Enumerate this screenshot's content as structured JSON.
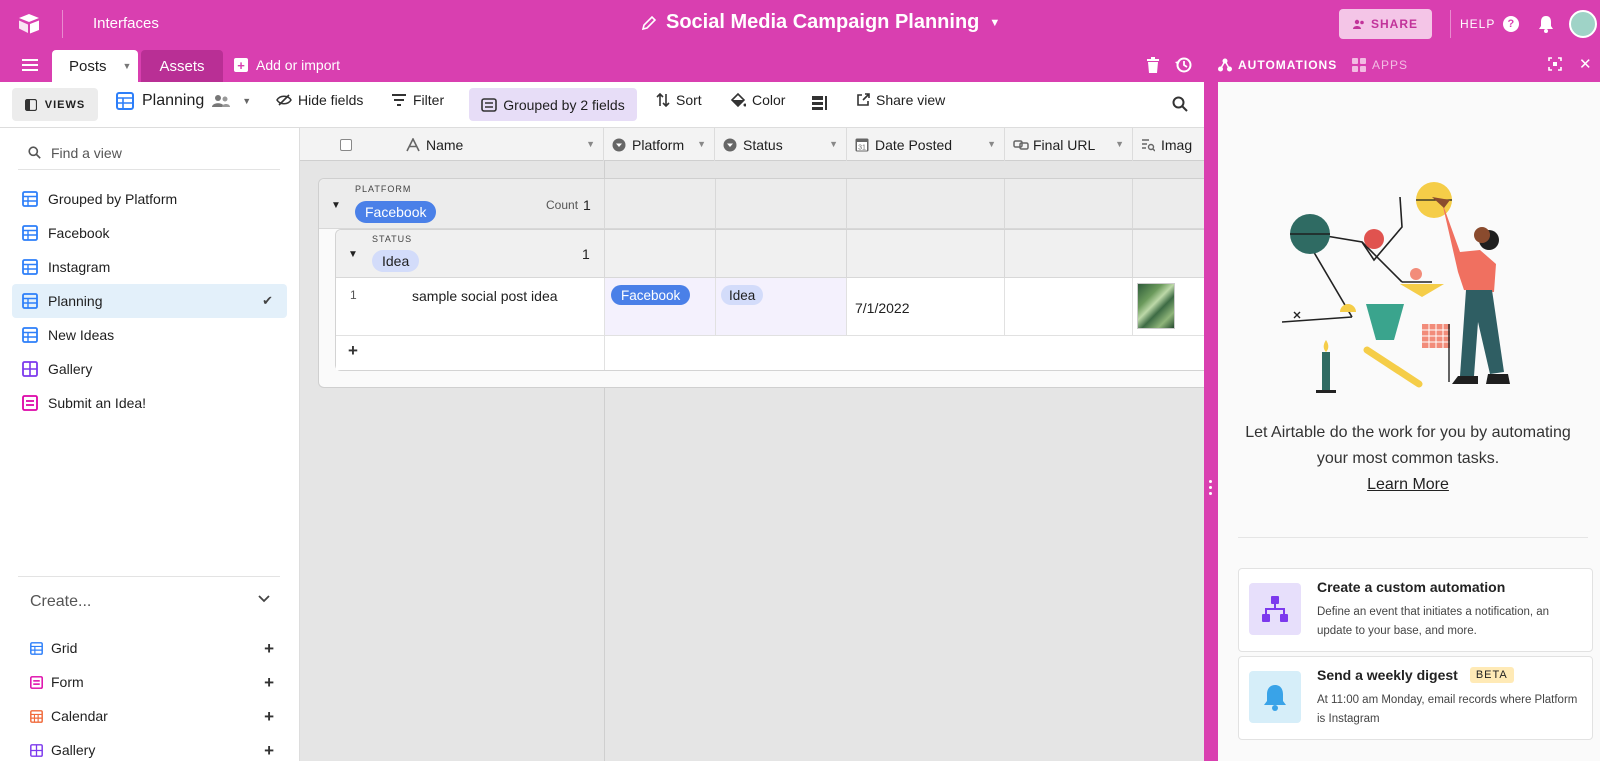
{
  "topbar": {
    "interfaces_label": "Interfaces",
    "base_title": "Social Media Campaign Planning",
    "share_label": "SHARE",
    "help_label": "HELP"
  },
  "tabbar": {
    "tabs": [
      {
        "label": "Posts",
        "active": true
      },
      {
        "label": "Assets",
        "active": false
      }
    ],
    "add_import_label": "Add or import",
    "automations_label": "AUTOMATIONS",
    "apps_label": "APPS"
  },
  "viewbar": {
    "views_label": "VIEWS",
    "current_view": "Planning",
    "hide_fields": "Hide fields",
    "filter": "Filter",
    "grouped": "Grouped by 2 fields",
    "sort": "Sort",
    "color": "Color",
    "share_view": "Share view"
  },
  "sidebar": {
    "find_placeholder": "Find a view",
    "views": [
      {
        "label": "Grouped by Platform",
        "icon": "grid-view-icon",
        "active": false
      },
      {
        "label": "Facebook",
        "icon": "grid-view-icon",
        "active": false
      },
      {
        "label": "Instagram",
        "icon": "grid-view-icon",
        "active": false
      },
      {
        "label": "Planning",
        "icon": "grid-view-icon",
        "active": true
      },
      {
        "label": "New Ideas",
        "icon": "grid-view-icon",
        "active": false
      },
      {
        "label": "Gallery",
        "icon": "gallery-view-icon",
        "active": false
      },
      {
        "label": "Submit an Idea!",
        "icon": "form-view-icon",
        "active": false
      }
    ],
    "create_label": "Create...",
    "create_items": [
      {
        "label": "Grid",
        "icon": "grid-view-icon"
      },
      {
        "label": "Form",
        "icon": "form-view-icon"
      },
      {
        "label": "Calendar",
        "icon": "calendar-view-icon"
      },
      {
        "label": "Gallery",
        "icon": "gallery-view-icon"
      }
    ]
  },
  "grid": {
    "columns": [
      {
        "label": "Name",
        "icon": "text-field-icon"
      },
      {
        "label": "Platform",
        "icon": "single-select-icon"
      },
      {
        "label": "Status",
        "icon": "single-select-icon"
      },
      {
        "label": "Date Posted",
        "icon": "date-field-icon"
      },
      {
        "label": "Final URL",
        "icon": "url-field-icon"
      },
      {
        "label": "Imag",
        "icon": "attachment-field-icon"
      }
    ],
    "group1": {
      "field": "PLATFORM",
      "value": "Facebook",
      "count_label": "Count",
      "count": "1"
    },
    "group2": {
      "field": "STATUS",
      "value": "Idea",
      "count": "1"
    },
    "records": [
      {
        "row_number": "1",
        "name": "sample social post idea",
        "platform": "Facebook",
        "status": "Idea",
        "date_posted": "7/1/2022",
        "final_url": ""
      }
    ],
    "add_row_label": "+"
  },
  "panel": {
    "message": "Let Airtable do the work for you by automating your most common tasks.",
    "learn_more": "Learn More",
    "cards": [
      {
        "title": "Create a custom automation",
        "description": "Define an event that initiates a notification, an update to your base, and more.",
        "badge": ""
      },
      {
        "title": "Send a weekly digest",
        "description": "At 11:00 am Monday, email records where Platform is Instagram",
        "badge": "BETA"
      }
    ]
  },
  "colors": {
    "brand": "#d93fb0",
    "facebook_pill": "#4a80e8",
    "idea_pill": "#d3dcfa",
    "grouped_bg": "#e7ddf7",
    "active_view_bg": "#e3f0fa"
  }
}
